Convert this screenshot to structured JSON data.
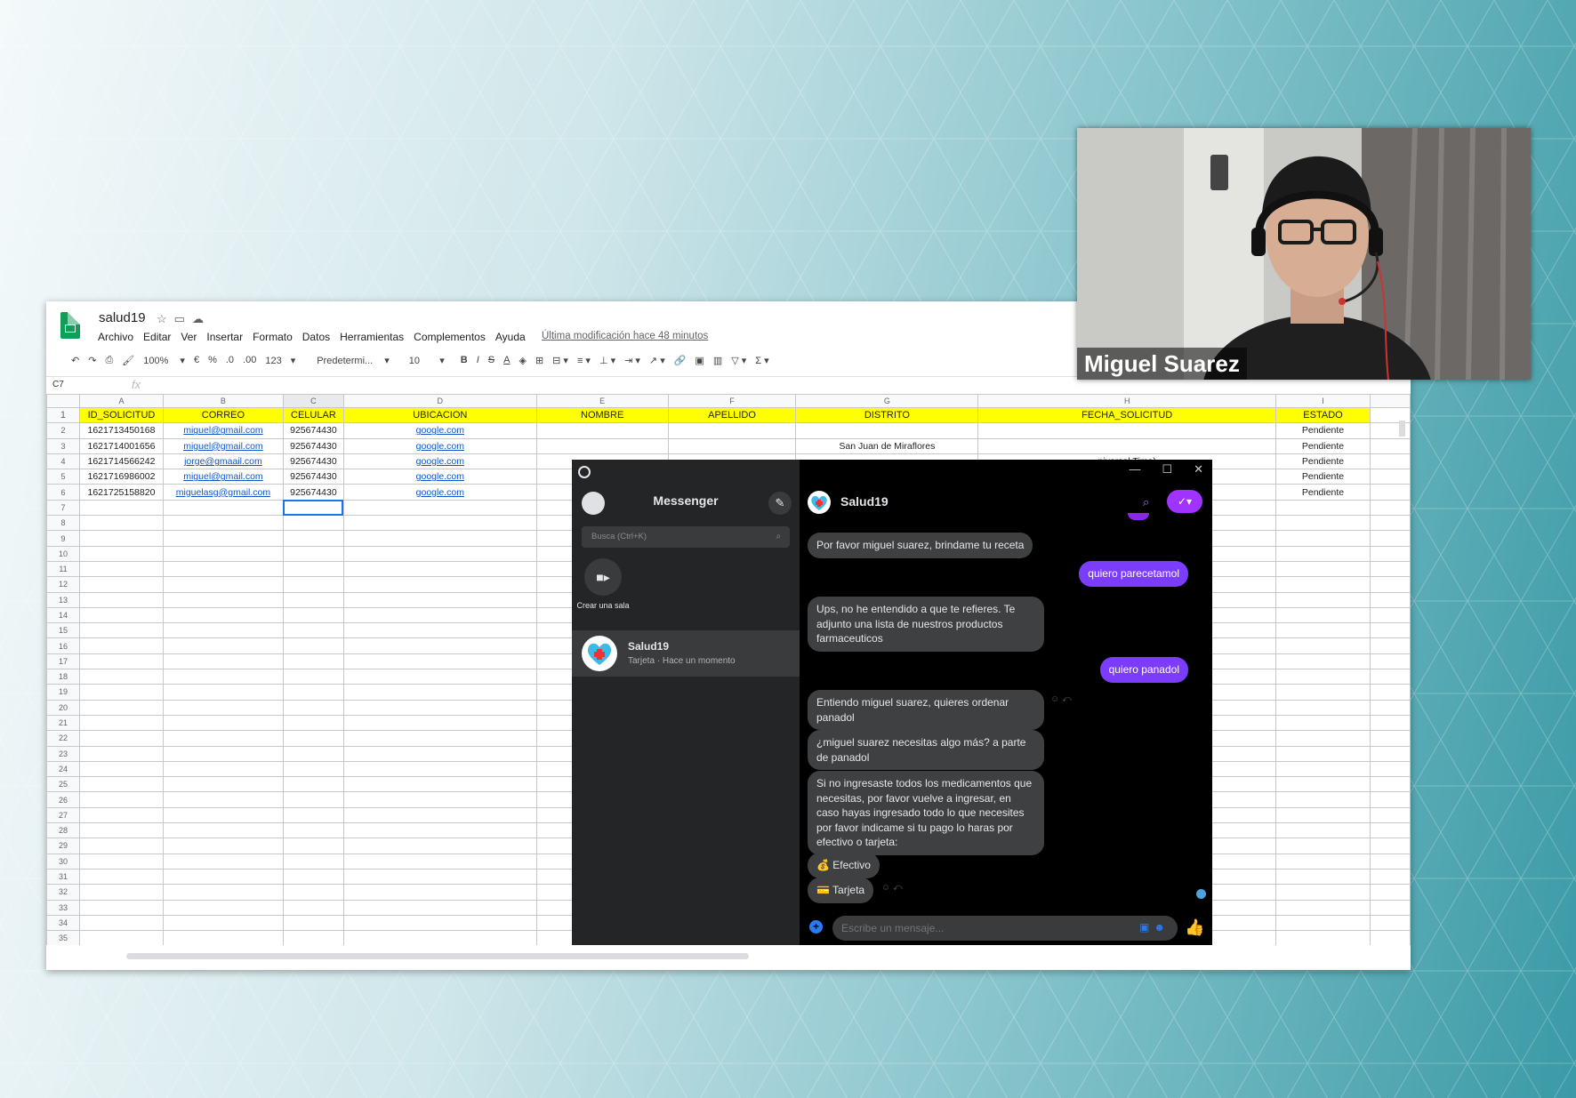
{
  "sheet": {
    "title": "salud19",
    "menu": [
      "Archivo",
      "Editar",
      "Ver",
      "Insertar",
      "Formato",
      "Datos",
      "Herramientas",
      "Complementos",
      "Ayuda"
    ],
    "last_modified": "Última modificación hace 48 minutos",
    "toolbar": {
      "zoom": "100%",
      "currency": "€",
      "percent": "%",
      "dec_less": ".0",
      "dec_more": ".00",
      "format": "123",
      "font": "Predetermi...",
      "size": "10"
    },
    "cell_ref": "C7",
    "fx": "fx",
    "columns": [
      "A",
      "B",
      "C",
      "D",
      "E",
      "F",
      "G",
      "H",
      "I"
    ],
    "headers": [
      "ID_SOLICITUD",
      "CORREO",
      "CELULAR",
      "UBICACION",
      "NOMBRE",
      "APELLIDO",
      "DISTRITO",
      "FECHA_SOLICITUD",
      "ESTADO"
    ],
    "rows": [
      [
        "1621713450168",
        "miguel@gmail.com",
        "925674430",
        "google.com",
        "",
        "",
        "",
        "",
        "Pendiente"
      ],
      [
        "1621714001656",
        "miguel@gmail.com",
        "925674430",
        "google.com",
        "",
        "",
        "San Juan de Miraflores",
        "",
        "Pendiente"
      ],
      [
        "1621714566242",
        "jorge@gmaail.com",
        "925674430",
        "google.com",
        "",
        "",
        "",
        "niversal Time)",
        "Pendiente"
      ],
      [
        "1621716986002",
        "miguel@gmail.com",
        "925674430",
        "google.com",
        "",
        "",
        "",
        "",
        "Pendiente"
      ],
      [
        "1621725158820",
        "miguelasg@gmail.com",
        "925674430",
        "google.com",
        "",
        "",
        "",
        "niversal Time)",
        "Pendiente"
      ]
    ],
    "row_count": 35
  },
  "messenger": {
    "title": "Messenger",
    "search_placeholder": "Busca (Ctrl+K)",
    "create_room": "Crear una sala",
    "conversation": {
      "name": "Salud19",
      "preview": "Tarjeta · Hace un momento"
    },
    "chat_name": "Salud19",
    "messages": [
      {
        "from": "bot",
        "text": "Por favor miguel suarez, brindame tu receta"
      },
      {
        "from": "me",
        "text": "quiero parecetamol"
      },
      {
        "from": "bot",
        "text": "Ups, no he entendido a que te refieres. Te adjunto una lista de nuestros productos farmaceuticos"
      },
      {
        "from": "me",
        "text": "quiero panadol"
      },
      {
        "from": "bot",
        "text": "Entiendo miguel suarez, quieres ordenar panadol"
      },
      {
        "from": "bot",
        "text": "¿miguel suarez necesitas algo más? a parte de panadol"
      },
      {
        "from": "bot",
        "text": "Si no ingresaste todos los medicamentos que necesitas, por favor vuelve a ingresar, en caso hayas ingresado todo lo que necesites por favor indicame si tu pago lo haras por efectivo o tarjeta:"
      },
      {
        "from": "bot",
        "text": "💰 Efectivo"
      },
      {
        "from": "bot",
        "text": "💳 Tarjeta"
      }
    ],
    "input_placeholder": "Escribe un mensaje..."
  },
  "webcam": {
    "name": "Miguel Suarez"
  }
}
